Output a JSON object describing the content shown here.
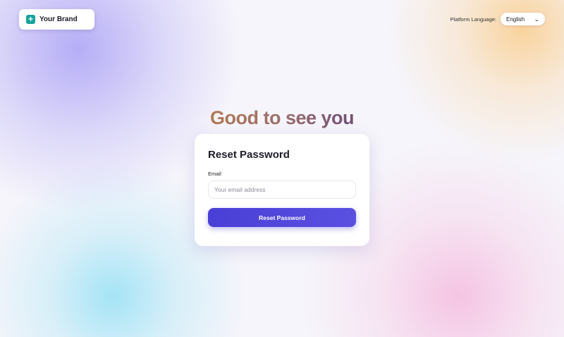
{
  "brand": {
    "icon": "plus-icon",
    "name": "Your Brand",
    "icon_color": "#16a39a"
  },
  "language": {
    "label": "Platform Language:",
    "selected": "English",
    "icon": "chevron-down-icon"
  },
  "headline": "Good to see you",
  "form": {
    "title": "Reset Password",
    "email_label": "Email",
    "email_placeholder": "Your email address",
    "email_value": "",
    "submit_label": "Reset Password",
    "accent_color": "#4a3fd6"
  }
}
